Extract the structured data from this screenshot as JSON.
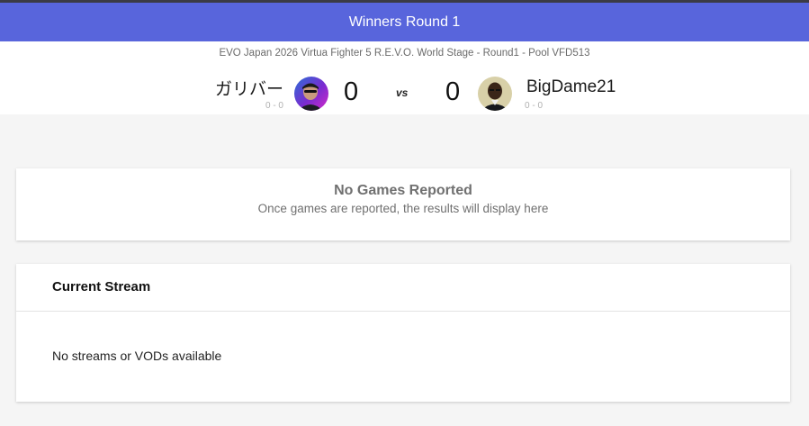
{
  "header": {
    "round_label": "Winners Round 1",
    "event_title": "EVO Japan 2026 Virtua Fighter 5 R.E.V.O. World Stage - Round1 - Pool VFD513"
  },
  "match": {
    "player1": {
      "name": "ガリバー",
      "record": "0 - 0",
      "score": "0",
      "avatar_icon": "player-avatar-photo"
    },
    "player2": {
      "name": "BigDame21",
      "record": "0 - 0",
      "score": "0",
      "avatar_icon": "player-avatar-photo"
    },
    "vs_label": "vs"
  },
  "games": {
    "empty_title": "No Games Reported",
    "empty_message": "Once games are reported, the results will display here"
  },
  "stream": {
    "heading": "Current Stream",
    "empty_message": "No streams or VODs available"
  },
  "colors": {
    "round_bar": "#5865dc",
    "page_background": "#f5f5f5"
  }
}
